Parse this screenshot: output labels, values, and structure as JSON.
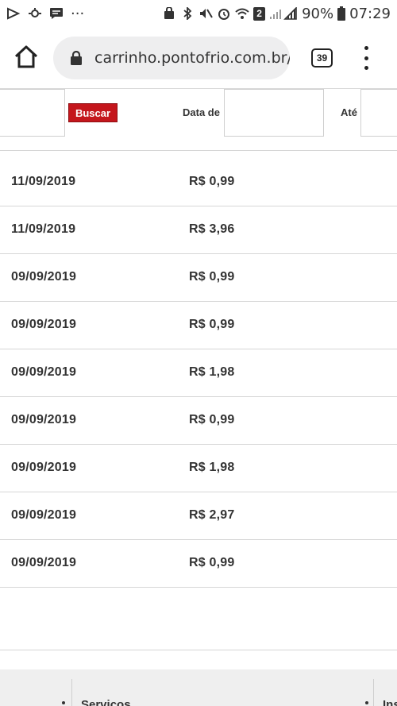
{
  "status_bar": {
    "battery_percent": "90%",
    "time": "07:29",
    "notification_badge": "2",
    "icons": [
      "play-store-icon",
      "connect-icon",
      "message-icon",
      "more-notifications-icon",
      "vpn-icon",
      "bluetooth-icon",
      "mute-icon",
      "alarm-icon",
      "wifi-icon",
      "sim-badge-icon",
      "signal-icon",
      "battery-icon"
    ]
  },
  "toolbar": {
    "url": "carrinho.pontofrio.com.br/",
    "tab_count": "39"
  },
  "filter": {
    "search_button": "Buscar",
    "date_from_label": "Data de",
    "date_to_label": "Até",
    "date_from_value": "",
    "date_to_value": ""
  },
  "rows": [
    {
      "date": "11/09/2019",
      "price": "R$ 0,99"
    },
    {
      "date": "11/09/2019",
      "price": "R$ 3,96"
    },
    {
      "date": "09/09/2019",
      "price": "R$ 0,99"
    },
    {
      "date": "09/09/2019",
      "price": "R$ 0,99"
    },
    {
      "date": "09/09/2019",
      "price": "R$ 1,98"
    },
    {
      "date": "09/09/2019",
      "price": "R$ 0,99"
    },
    {
      "date": "09/09/2019",
      "price": "R$ 1,98"
    },
    {
      "date": "09/09/2019",
      "price": "R$ 2,97"
    },
    {
      "date": "09/09/2019",
      "price": "R$ 0,99"
    }
  ],
  "footer": {
    "services_label": "Serviços",
    "ins_label": "Ins"
  },
  "colors": {
    "accent": "#c4161c",
    "url_bar_bg": "#eeeeef",
    "footer_bg": "#efefef"
  }
}
